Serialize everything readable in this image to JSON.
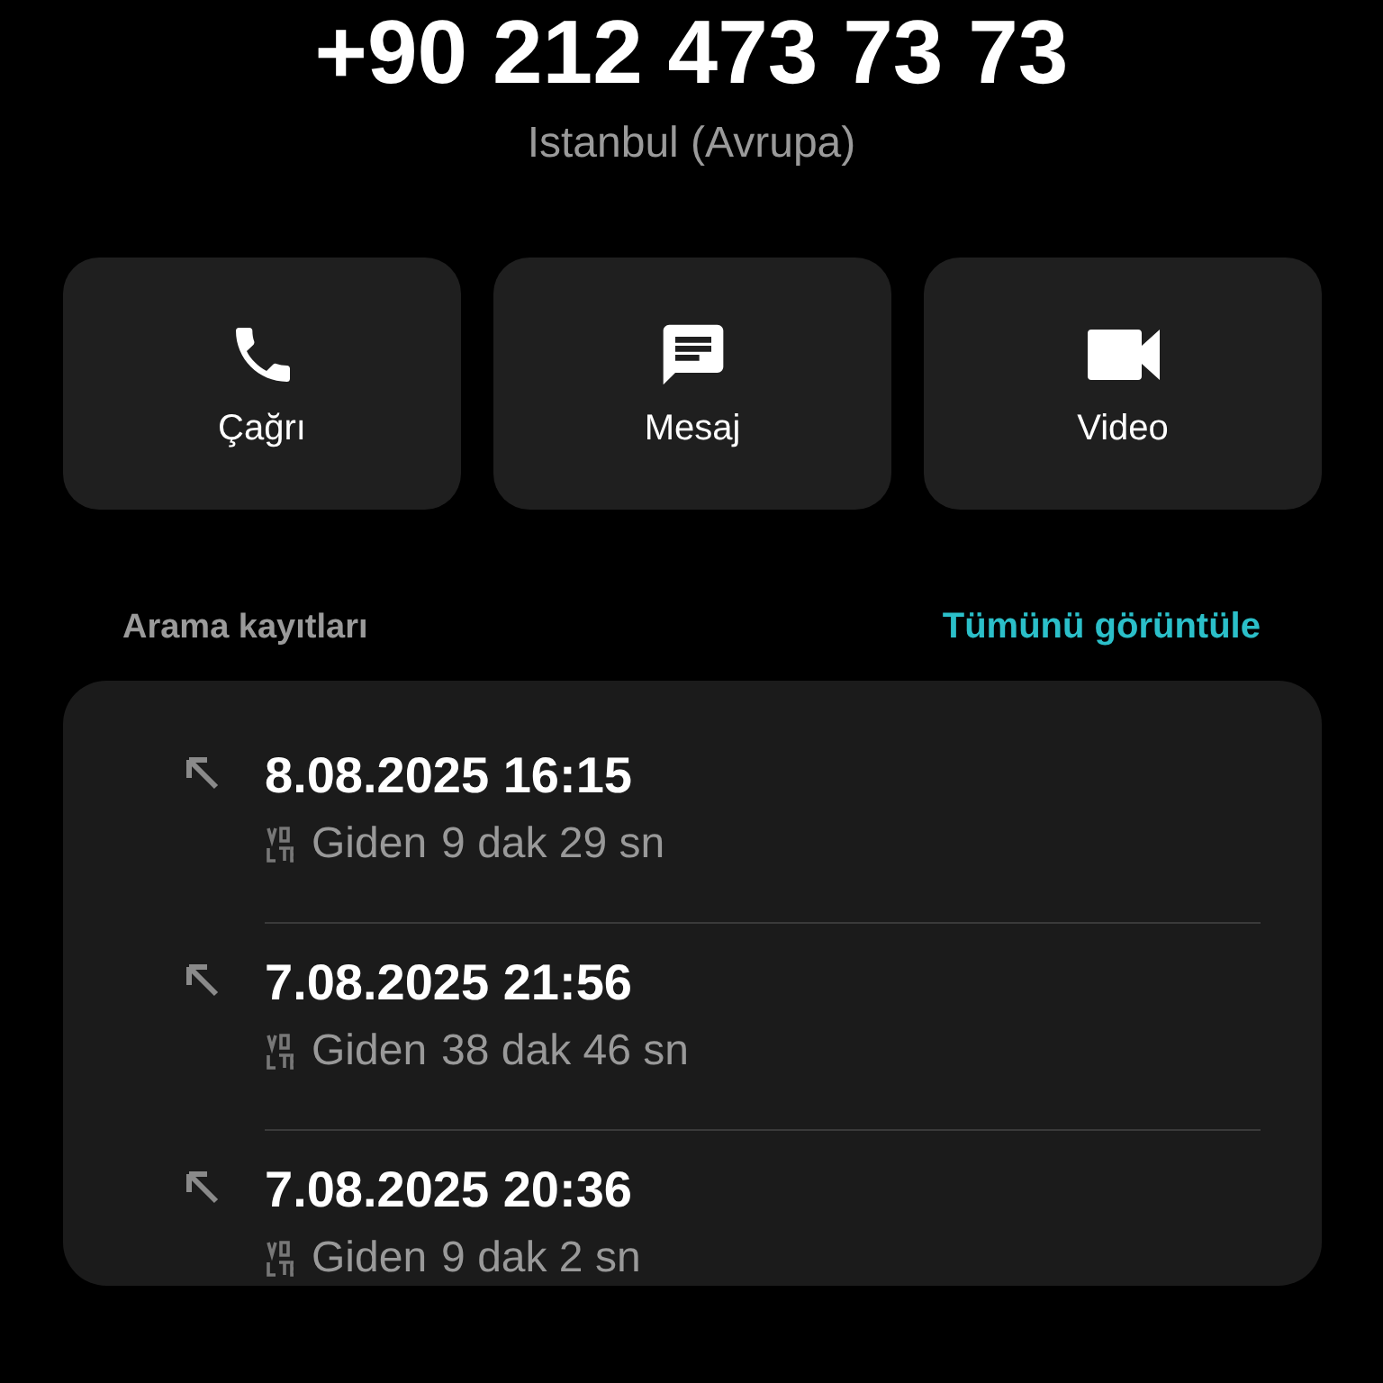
{
  "contact": {
    "number": "+90 212 473 73 73",
    "location": "Istanbul (Avrupa)"
  },
  "actions": [
    {
      "kind": "call",
      "label": "Çağrı"
    },
    {
      "kind": "message",
      "label": "Mesaj"
    },
    {
      "kind": "video",
      "label": "Video"
    }
  ],
  "call_log": {
    "title": "Arama kayıtları",
    "link": "Tümünü görüntüle",
    "entries": [
      {
        "kind": "outgoing",
        "datetime": "8.08.2025 16:15",
        "type": "Giden",
        "duration": "9 dak 29 sn"
      },
      {
        "kind": "outgoing",
        "datetime": "7.08.2025 21:56",
        "type": "Giden",
        "duration": "38 dak 46 sn"
      },
      {
        "kind": "outgoing",
        "datetime": "7.08.2025 20:36",
        "type": "Giden",
        "duration": "9 dak 2 sn"
      }
    ]
  }
}
